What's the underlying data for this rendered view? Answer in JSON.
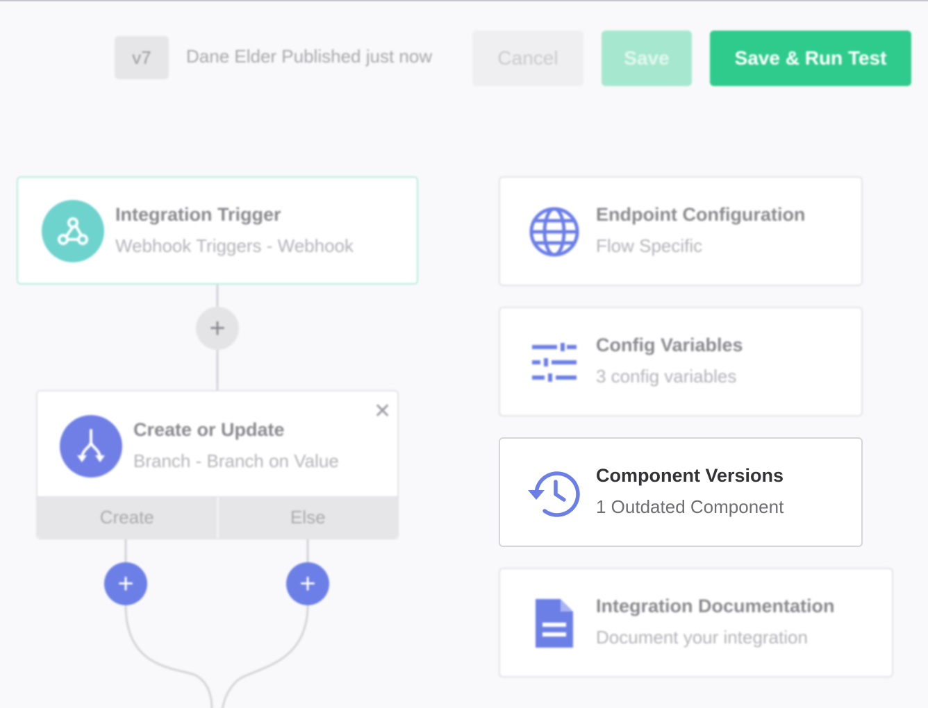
{
  "header": {
    "version": "v7",
    "publish_status": "Dane Elder Published just now",
    "cancel_label": "Cancel",
    "save_label": "Save",
    "save_run_label": "Save & Run Test"
  },
  "trigger": {
    "title": "Integration Trigger",
    "subtitle": "Webhook Triggers - Webhook",
    "icon": "webhook-icon"
  },
  "branch_step": {
    "title": "Create or Update",
    "subtitle": "Branch - Branch on Value",
    "icon": "branch-icon",
    "branches": [
      "Create",
      "Else"
    ]
  },
  "side_cards": [
    {
      "title": "Endpoint Configuration",
      "subtitle": "Flow Specific",
      "icon": "globe-icon"
    },
    {
      "title": "Config Variables",
      "subtitle": "3 config variables",
      "icon": "sliders-icon"
    },
    {
      "title": "Component Versions",
      "subtitle": "1 Outdated Component",
      "icon": "history-icon"
    },
    {
      "title": "Integration Documentation",
      "subtitle": "Document your integration",
      "icon": "document-icon"
    }
  ],
  "colors": {
    "accent_green": "#2ecb8c",
    "accent_blue": "#6b7fe6",
    "trigger_teal": "#6ed3cd"
  }
}
